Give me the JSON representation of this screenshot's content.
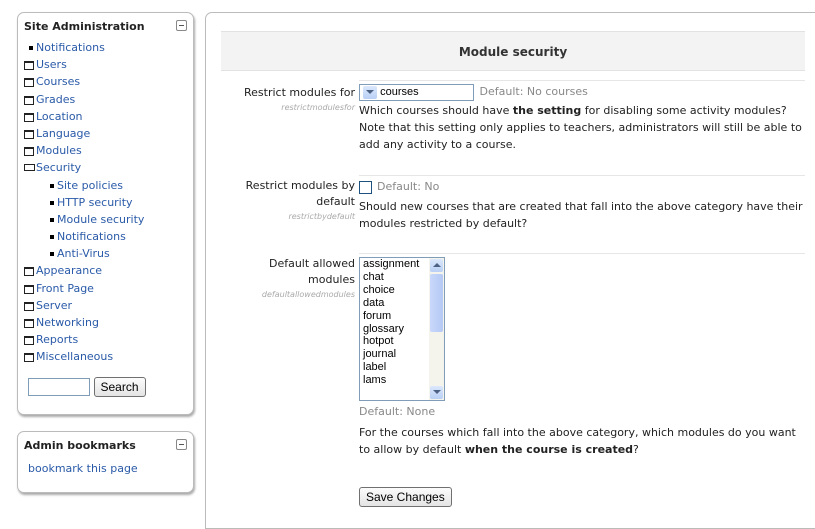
{
  "sidebar": {
    "title": "Site Administration",
    "items": [
      {
        "label": "Notifications",
        "level": 0,
        "type": "leaf"
      },
      {
        "label": "Users",
        "level": 0,
        "type": "folder"
      },
      {
        "label": "Courses",
        "level": 0,
        "type": "folder"
      },
      {
        "label": "Grades",
        "level": 0,
        "type": "folder"
      },
      {
        "label": "Location",
        "level": 0,
        "type": "folder"
      },
      {
        "label": "Language",
        "level": 0,
        "type": "folder"
      },
      {
        "label": "Modules",
        "level": 0,
        "type": "folder"
      },
      {
        "label": "Security",
        "level": 0,
        "type": "folder-open"
      },
      {
        "label": "Site policies",
        "level": 1,
        "type": "leaf"
      },
      {
        "label": "HTTP security",
        "level": 1,
        "type": "leaf"
      },
      {
        "label": "Module security",
        "level": 1,
        "type": "leaf"
      },
      {
        "label": "Notifications",
        "level": 1,
        "type": "leaf"
      },
      {
        "label": "Anti-Virus",
        "level": 1,
        "type": "leaf"
      },
      {
        "label": "Appearance",
        "level": 0,
        "type": "folder"
      },
      {
        "label": "Front Page",
        "level": 0,
        "type": "folder"
      },
      {
        "label": "Server",
        "level": 0,
        "type": "folder"
      },
      {
        "label": "Networking",
        "level": 0,
        "type": "folder"
      },
      {
        "label": "Reports",
        "level": 0,
        "type": "folder"
      },
      {
        "label": "Miscellaneous",
        "level": 0,
        "type": "folder"
      }
    ],
    "search": {
      "value": "",
      "button": "Search"
    }
  },
  "bookmarks": {
    "title": "Admin bookmarks",
    "link": "bookmark this page"
  },
  "main": {
    "heading": "Module security",
    "restrict_modules": {
      "label": "Restrict modules for",
      "name": "restrictmodulesfor",
      "selected": "No courses",
      "default": "Default: No courses",
      "desc_a": "Which courses should have ",
      "desc_bold": "the setting",
      "desc_b": " for disabling some activity modules? Note that this setting only applies to teachers, administrators will still be able to add any activity to a course."
    },
    "restrict_default": {
      "label_1": "Restrict modules by",
      "label_2": "default",
      "name": "restrictbydefault",
      "default": "Default: No",
      "desc": "Should new courses that are created that fall into the above category have their modules restricted by default?"
    },
    "allowed_modules": {
      "label_1": "Default allowed",
      "label_2": "modules",
      "name": "defaultallowedmodules",
      "options": [
        "assignment",
        "chat",
        "choice",
        "data",
        "forum",
        "glossary",
        "hotpot",
        "journal",
        "label",
        "lams"
      ],
      "default": "Default: None",
      "desc_a": "For the courses which fall into the above category, which modules do you want to allow by default ",
      "desc_bold": "when the course is created",
      "desc_b": "?"
    },
    "save_button": "Save Changes"
  }
}
